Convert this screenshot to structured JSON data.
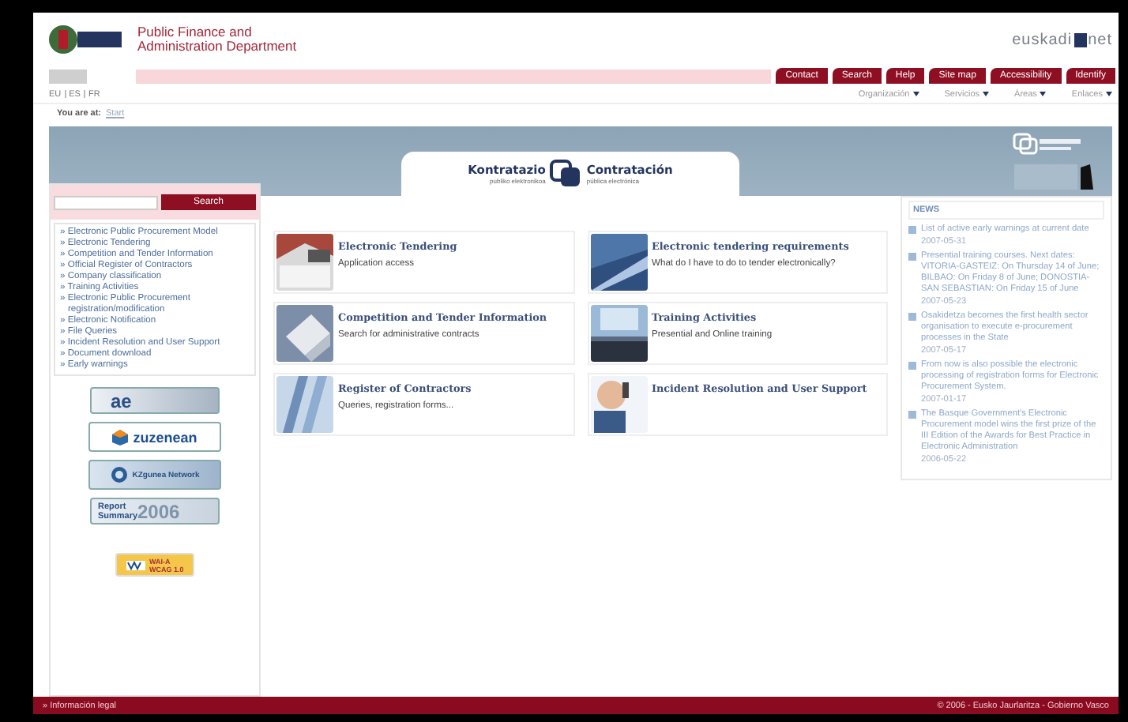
{
  "header": {
    "title": "Public Finance and Administration Department",
    "brand": {
      "left": "euskadi",
      "right": "net"
    }
  },
  "top_buttons": [
    "Contact",
    "Search",
    "Help",
    "Site map",
    "Accessibility",
    "Identify"
  ],
  "languages": [
    "EU",
    "ES",
    "FR"
  ],
  "menus": [
    "Organización",
    "Servicios",
    "Áreas",
    "Enlaces"
  ],
  "breadcrumb": {
    "label": "You are at:",
    "link": "Start"
  },
  "banner": {
    "left_logo": {
      "title": "Kontratazio",
      "subtitle": "publiko elektronikoa"
    },
    "right_logo": {
      "title": "Contratación",
      "subtitle": "pública electrónica"
    }
  },
  "search": {
    "button": "Search"
  },
  "sidebar": {
    "items": [
      "» Electronic Public Procurement Model",
      "» Electronic Tendering",
      "» Competition and Tender Information",
      "» Official Register of Contractors",
      "» Company classification",
      "» Training Activities",
      "» Electronic Public Procurement registration/modification",
      "» Electronic Notification",
      "» File Queries",
      "» Incident Resolution and User Support",
      "» Document download",
      "» Early warnings"
    ]
  },
  "badges": [
    {
      "kind": "ae",
      "text": "ae"
    },
    {
      "kind": "zuzenean",
      "text": "zuzenean"
    },
    {
      "kind": "kzgunea",
      "text": "KZgunea Network"
    },
    {
      "kind": "report",
      "text": "Report Summary",
      "year": "2006"
    },
    {
      "kind": "wai",
      "text": "WAI-A",
      "subtext": "WCAG 1.0"
    }
  ],
  "cards": [
    {
      "title": "Electronic Tendering",
      "subtitle": "Application access",
      "kind": "picture"
    },
    {
      "title": "Electronic tendering requirements",
      "subtitle": "What do I have to do to tender electronically?",
      "kind": "picture"
    },
    {
      "title": "Competition and Tender Information",
      "subtitle": "Search for administrative contracts",
      "kind": "picture"
    },
    {
      "title": "Training Activities",
      "subtitle": "Presential and Online training",
      "kind": "picture"
    },
    {
      "title": "Register of Contractors",
      "subtitle": "Queries, registration forms...",
      "kind": "picture"
    },
    {
      "title": "Incident Resolution and User Support",
      "kind": "picture"
    }
  ],
  "news": {
    "heading": "NEWS",
    "items": [
      {
        "text": "List of active early warnings at current date",
        "date": "2007-05-31"
      },
      {
        "text": "Presential training courses. Next dates: VITORIA-GASTEIZ: On Thursday 14 of June; BILBAO: On Friday 8 of June; DONOSTIA-SAN SEBASTIAN: On Friday 15 of June",
        "date": "2007-05-23"
      },
      {
        "text": "Osakidetza becomes the first health sector organisation to execute e-procurement processes in the State",
        "date": "2007-05-17"
      },
      {
        "text": "From now is also possible the electronic processing of registration forms for Electronic Procurement System.",
        "date": "2007-01-17"
      },
      {
        "text": "The Basque Government's Electronic Procurement model wins the first prize of the III Edition of the Awards for Best Practice in Electronic Administration",
        "date": "2006-05-22"
      }
    ]
  },
  "footer": {
    "left": "» Información legal",
    "right": "© 2006 - Eusko Jaurlaritza - Gobierno Vasco"
  }
}
